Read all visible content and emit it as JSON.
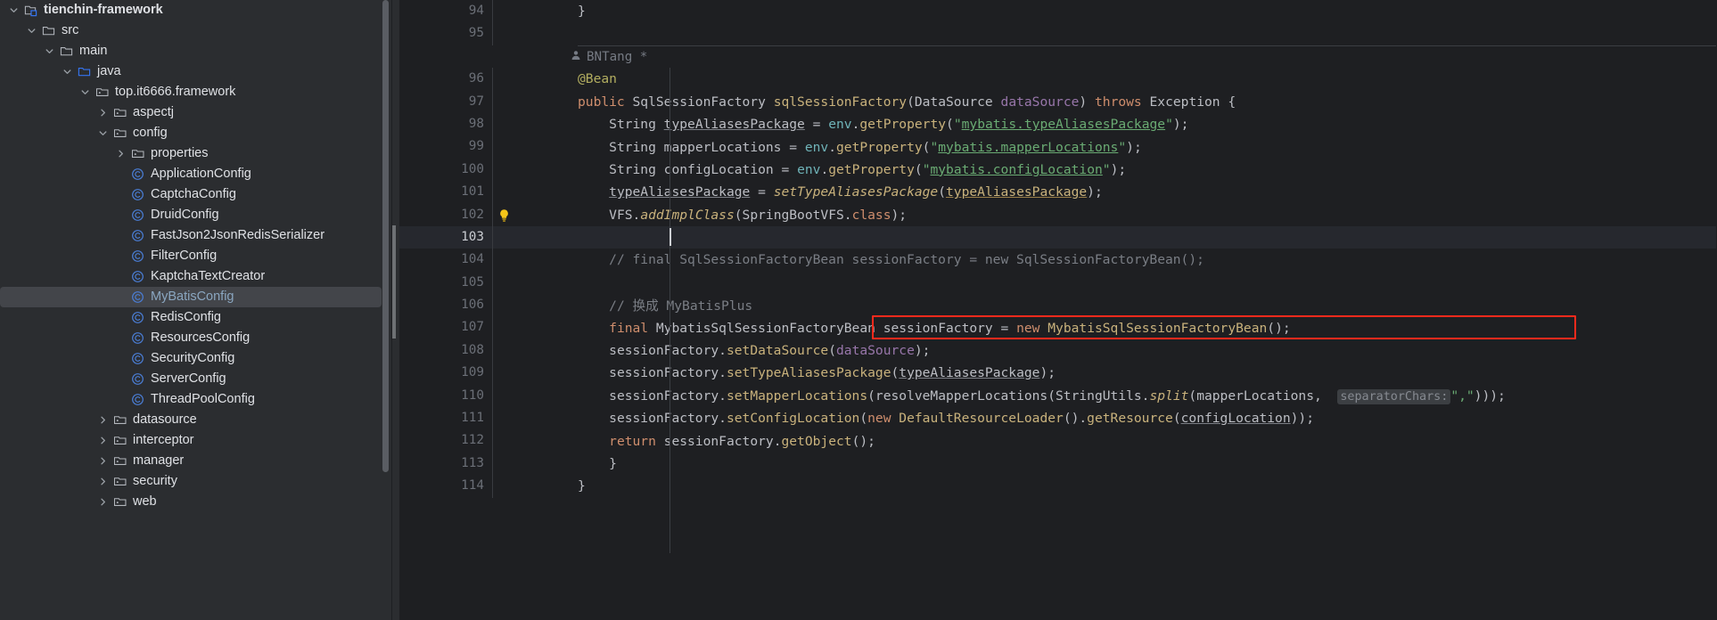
{
  "app": {
    "theme": "IntelliJ IDEA Dark",
    "accent_red": "#ff2a1c",
    "bg_tree": "#2b2d30",
    "bg_editor": "#1e1f22"
  },
  "project_tree": {
    "items": [
      {
        "label": "tienchin-framework",
        "depth": 0,
        "twisty": "expanded",
        "icon": "module-icon",
        "selected": false,
        "root": true
      },
      {
        "label": "src",
        "depth": 1,
        "twisty": "expanded",
        "icon": "folder-icon",
        "selected": false
      },
      {
        "label": "main",
        "depth": 2,
        "twisty": "expanded",
        "icon": "folder-icon",
        "selected": false
      },
      {
        "label": "java",
        "depth": 3,
        "twisty": "expanded",
        "icon": "source-folder-icon",
        "selected": false
      },
      {
        "label": "top.it6666.framework",
        "depth": 4,
        "twisty": "expanded",
        "icon": "package-icon",
        "selected": false
      },
      {
        "label": "aspectj",
        "depth": 5,
        "twisty": "collapsed",
        "icon": "package-icon",
        "selected": false
      },
      {
        "label": "config",
        "depth": 5,
        "twisty": "expanded",
        "icon": "package-icon",
        "selected": false
      },
      {
        "label": "properties",
        "depth": 6,
        "twisty": "collapsed",
        "icon": "package-icon",
        "selected": false
      },
      {
        "label": "ApplicationConfig",
        "depth": 6,
        "twisty": "none",
        "icon": "java-class-icon",
        "selected": false
      },
      {
        "label": "CaptchaConfig",
        "depth": 6,
        "twisty": "none",
        "icon": "java-class-icon",
        "selected": false
      },
      {
        "label": "DruidConfig",
        "depth": 6,
        "twisty": "none",
        "icon": "java-class-icon",
        "selected": false
      },
      {
        "label": "FastJson2JsonRedisSerializer",
        "depth": 6,
        "twisty": "none",
        "icon": "java-class-icon",
        "selected": false
      },
      {
        "label": "FilterConfig",
        "depth": 6,
        "twisty": "none",
        "icon": "java-class-icon",
        "selected": false
      },
      {
        "label": "KaptchaTextCreator",
        "depth": 6,
        "twisty": "none",
        "icon": "java-class-icon",
        "selected": false
      },
      {
        "label": "MyBatisConfig",
        "depth": 6,
        "twisty": "none",
        "icon": "java-class-icon",
        "selected": true
      },
      {
        "label": "RedisConfig",
        "depth": 6,
        "twisty": "none",
        "icon": "java-class-icon",
        "selected": false
      },
      {
        "label": "ResourcesConfig",
        "depth": 6,
        "twisty": "none",
        "icon": "java-class-icon",
        "selected": false
      },
      {
        "label": "SecurityConfig",
        "depth": 6,
        "twisty": "none",
        "icon": "java-class-icon",
        "selected": false
      },
      {
        "label": "ServerConfig",
        "depth": 6,
        "twisty": "none",
        "icon": "java-class-icon",
        "selected": false
      },
      {
        "label": "ThreadPoolConfig",
        "depth": 6,
        "twisty": "none",
        "icon": "java-class-icon",
        "selected": false
      },
      {
        "label": "datasource",
        "depth": 5,
        "twisty": "collapsed",
        "icon": "package-icon",
        "selected": false
      },
      {
        "label": "interceptor",
        "depth": 5,
        "twisty": "collapsed",
        "icon": "package-icon",
        "selected": false
      },
      {
        "label": "manager",
        "depth": 5,
        "twisty": "collapsed",
        "icon": "package-icon",
        "selected": false
      },
      {
        "label": "security",
        "depth": 5,
        "twisty": "collapsed",
        "icon": "package-icon",
        "selected": false
      },
      {
        "label": "web",
        "depth": 5,
        "twisty": "collapsed",
        "icon": "package-icon",
        "selected": false
      }
    ]
  },
  "editor": {
    "author_annotation": "BNTang *",
    "caret_line": 103,
    "highlighted_line": 107,
    "inlay_hint": "separatorChars:",
    "line_numbers": [
      94,
      95,
      96,
      97,
      98,
      99,
      100,
      101,
      102,
      103,
      104,
      105,
      106,
      107,
      108,
      109,
      110,
      111,
      112,
      113,
      114
    ],
    "lines": {
      "94": "}",
      "95": "",
      "96": "@Bean",
      "97": "public SqlSessionFactory sqlSessionFactory(DataSource dataSource) throws Exception {",
      "98": "    String typeAliasesPackage = env.getProperty(\"mybatis.typeAliasesPackage\");",
      "99": "    String mapperLocations = env.getProperty(\"mybatis.mapperLocations\");",
      "100": "    String configLocation = env.getProperty(\"mybatis.configLocation\");",
      "101": "    typeAliasesPackage = setTypeAliasesPackage(typeAliasesPackage);",
      "102": "    VFS.addImplClass(SpringBootVFS.class);",
      "103": "",
      "104": "    // final SqlSessionFactoryBean sessionFactory = new SqlSessionFactoryBean();",
      "105": "",
      "106": "    // 换成 MyBatisPlus",
      "107": "    final MybatisSqlSessionFactoryBean sessionFactory = new MybatisSqlSessionFactoryBean();",
      "108": "    sessionFactory.setDataSource(dataSource);",
      "109": "    sessionFactory.setTypeAliasesPackage(typeAliasesPackage);",
      "110": "    sessionFactory.setMapperLocations(resolveMapperLocations(StringUtils.split(mapperLocations, separatorChars: \",\")));",
      "111": "    sessionFactory.setConfigLocation(new DefaultResourceLoader().getResource(configLocation));",
      "112": "    return sessionFactory.getObject();",
      "113": "}",
      "114": "}"
    },
    "gutter_icons": {
      "96": [
        "override-method-icon",
        "implemented-method-icon"
      ],
      "97": [
        "implementing-method-icon"
      ]
    },
    "intention_bulb_line": 102
  }
}
